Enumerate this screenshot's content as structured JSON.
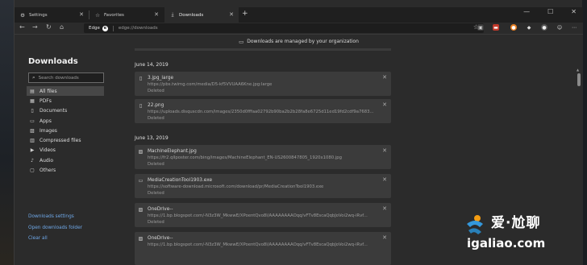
{
  "tabs": [
    {
      "label": "Settings",
      "icon": "gear-icon"
    },
    {
      "label": "Favorites",
      "icon": "star-icon"
    },
    {
      "label": "Downloads",
      "icon": "download-icon",
      "active": true
    }
  ],
  "toolbar": {
    "brand": "Edge",
    "url": "edge://downloads"
  },
  "banner": {
    "text": "Downloads are managed by your organization"
  },
  "sidebar": {
    "title": "Downloads",
    "search_placeholder": "Search downloads",
    "items": [
      {
        "label": "All files",
        "icon": "all-files-icon",
        "active": true
      },
      {
        "label": "PDFs",
        "icon": "pdf-icon"
      },
      {
        "label": "Documents",
        "icon": "document-icon"
      },
      {
        "label": "Apps",
        "icon": "apps-icon"
      },
      {
        "label": "Images",
        "icon": "image-icon"
      },
      {
        "label": "Compressed files",
        "icon": "compressed-icon"
      },
      {
        "label": "Videos",
        "icon": "video-icon"
      },
      {
        "label": "Audio",
        "icon": "audio-icon"
      },
      {
        "label": "Others",
        "icon": "others-icon"
      }
    ],
    "links": {
      "settings": "Downloads settings",
      "open_folder": "Open downloads folder",
      "clear_all": "Clear all"
    }
  },
  "groups": [
    {
      "date": "June 14, 2019",
      "items": [
        {
          "name": "3.jpg_large",
          "url": "https://pbs.twimg.com/media/D5-kf5VVUAA6Kne.jpg:large",
          "status": "Deleted"
        },
        {
          "name": "22.png",
          "url": "https://uploads.disquscdn.com/images/2350d0fffaa02792b90ba2b2b28fa8e6725d11ed19fd2cdf9a7683...",
          "status": "Deleted"
        }
      ]
    },
    {
      "date": "June 13, 2019",
      "items": [
        {
          "name": "MachineElephant.jpg",
          "url": "https://fr2.qllposter.com/bing/images/MachineElephant_EN-US2600847805_1920x1080.jpg",
          "status": "Deleted"
        },
        {
          "name": "MediaCreationTool1903.exe",
          "url": "https://software-download.microsoft.com/download/pr/MediaCreationTool1903.exe",
          "status": "Deleted"
        },
        {
          "name": "OneDrive--",
          "url": "https://1.bp.blogspot.com/-N3z3W_MkwwE/XPoentQvo8I/AAAAAAAAOqq/vFTv8EscaQqbJoVoi2wq-iRvf...",
          "status": "Deleted"
        },
        {
          "name": "OneDrive--",
          "url": "https://1.bp.blogspot.com/-N3z3W_MkwwE/XPoentQvo8I/AAAAAAAAOqq/vFTv8EscaQqbJoVoi2wq-iRvf...",
          "status": ""
        }
      ]
    }
  ],
  "watermark": {
    "cn": "爱·尬聊",
    "domain": "igaliao.com"
  }
}
